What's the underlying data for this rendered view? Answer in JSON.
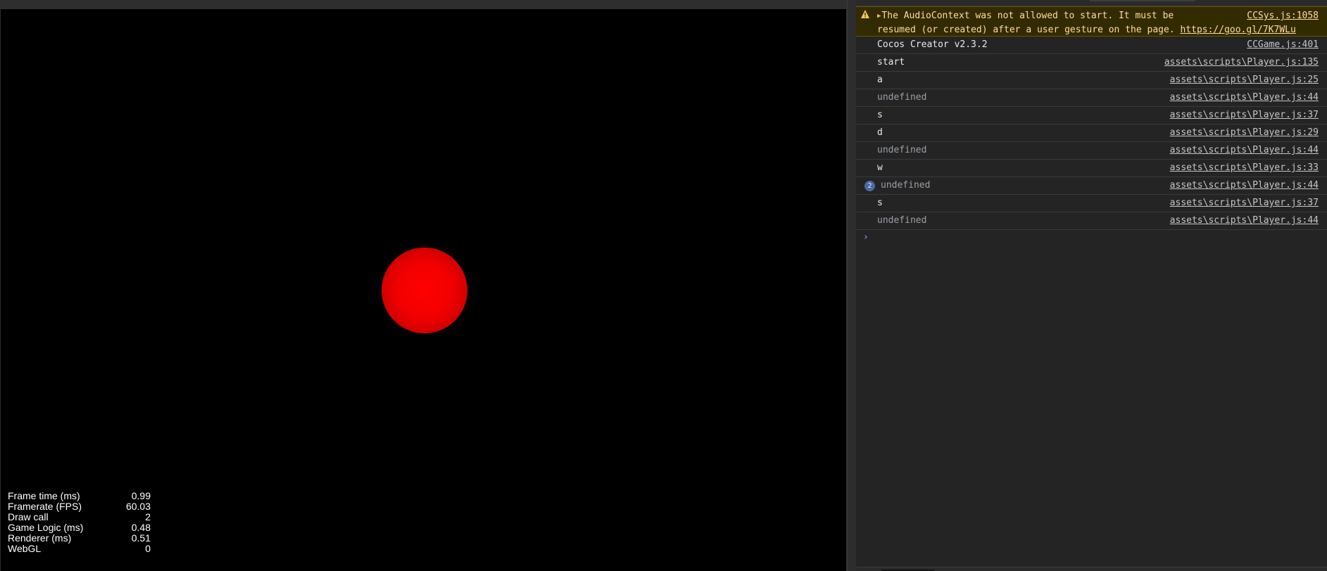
{
  "stats": [
    {
      "label": "Frame time (ms)",
      "value": "0.99"
    },
    {
      "label": "Framerate (FPS)",
      "value": "60.03"
    },
    {
      "label": "Draw call",
      "value": "2"
    },
    {
      "label": "Game Logic (ms)",
      "value": "0.48"
    },
    {
      "label": "Renderer (ms)",
      "value": "0.51"
    },
    {
      "label": "WebGL",
      "value": "0"
    }
  ],
  "console": {
    "warning": {
      "icon": "warning-icon",
      "line1": "The AudioContext was not allowed to start. It must be",
      "line2": "resumed (or created) after a user gesture on the page.",
      "link": "https://goo.gl/7K7WLu",
      "source": "CCSys.js:1058"
    },
    "logs": [
      {
        "msg": "Cocos Creator v2.3.2",
        "src": "CCGame.js:401"
      },
      {
        "msg": "start",
        "src": "assets\\scripts\\Player.js:135"
      },
      {
        "msg": "a",
        "src": "assets\\scripts\\Player.js:25"
      },
      {
        "msg": "undefined",
        "src": "assets\\scripts\\Player.js:44"
      },
      {
        "msg": "s",
        "src": "assets\\scripts\\Player.js:37"
      },
      {
        "msg": "d",
        "src": "assets\\scripts\\Player.js:29"
      },
      {
        "msg": "undefined",
        "src": "assets\\scripts\\Player.js:44"
      },
      {
        "msg": "w",
        "src": "assets\\scripts\\Player.js:33"
      },
      {
        "msg": "undefined",
        "src": "assets\\scripts\\Player.js:44",
        "count": "2"
      },
      {
        "msg": "s",
        "src": "assets\\scripts\\Player.js:37"
      },
      {
        "msg": "undefined",
        "src": "assets\\scripts\\Player.js:44"
      }
    ],
    "prompt_icon": "chevron-right-icon",
    "prompt_glyph": "›"
  },
  "colors": {
    "ball": "#ff0000",
    "warning_bg": "#332b00",
    "warning_text": "#ffdd9e",
    "prompt": "#7cacf8"
  }
}
